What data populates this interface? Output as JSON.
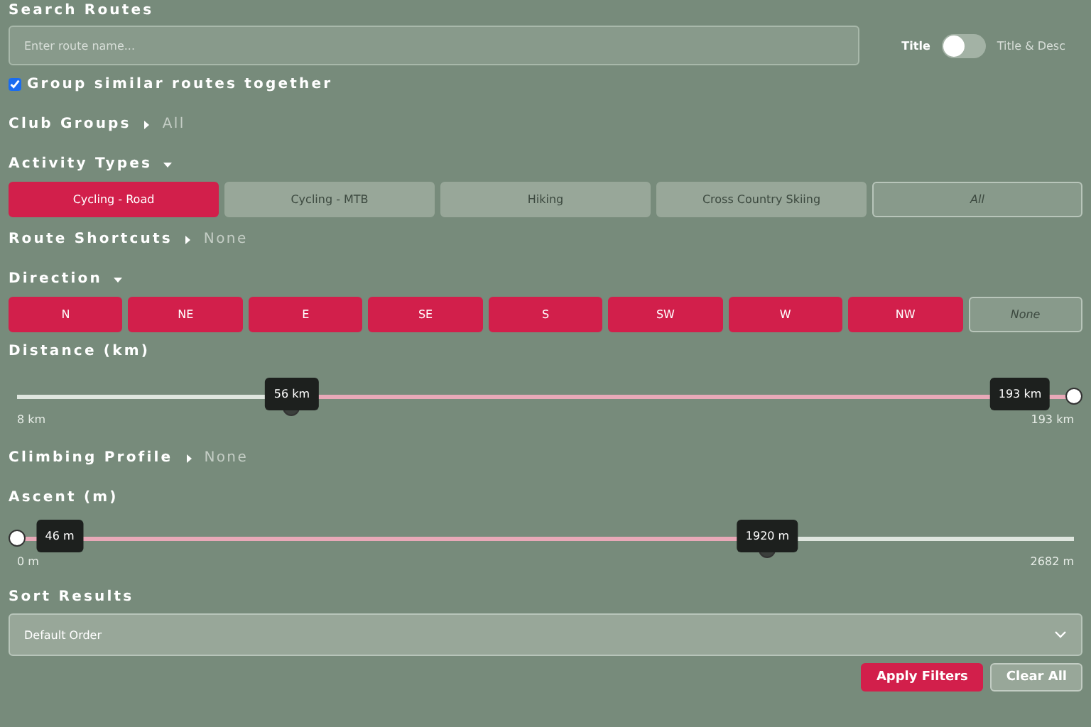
{
  "search": {
    "label": "Search Routes",
    "placeholder": "Enter route name...",
    "toggle": {
      "left_label": "Title",
      "right_label": "Title & Desc",
      "on": false
    }
  },
  "group_similar": {
    "label": "Group similar routes together",
    "checked": true
  },
  "club_groups": {
    "label": "Club Groups",
    "value": "All",
    "expanded": false
  },
  "activity_types": {
    "label": "Activity Types",
    "expanded": true,
    "options": [
      {
        "label": "Cycling - Road",
        "selected": true,
        "kind": "option"
      },
      {
        "label": "Cycling - MTB",
        "selected": false,
        "kind": "option"
      },
      {
        "label": "Hiking",
        "selected": false,
        "kind": "option"
      },
      {
        "label": "Cross Country Skiing",
        "selected": false,
        "kind": "option"
      },
      {
        "label": "All",
        "selected": false,
        "kind": "all"
      }
    ]
  },
  "route_shortcuts": {
    "label": "Route Shortcuts",
    "value": "None",
    "expanded": false
  },
  "direction": {
    "label": "Direction",
    "expanded": true,
    "options": [
      {
        "label": "N",
        "selected": true,
        "kind": "option"
      },
      {
        "label": "NE",
        "selected": true,
        "kind": "option"
      },
      {
        "label": "E",
        "selected": true,
        "kind": "option"
      },
      {
        "label": "SE",
        "selected": true,
        "kind": "option"
      },
      {
        "label": "S",
        "selected": true,
        "kind": "option"
      },
      {
        "label": "SW",
        "selected": true,
        "kind": "option"
      },
      {
        "label": "W",
        "selected": true,
        "kind": "option"
      },
      {
        "label": "NW",
        "selected": true,
        "kind": "option"
      },
      {
        "label": "None",
        "selected": false,
        "kind": "all"
      }
    ]
  },
  "distance": {
    "label": "Distance (km)",
    "min_label": "8 km",
    "max_label": "193 km",
    "thumbs": [
      {
        "level": 0.26,
        "reading": "56 km"
      },
      {
        "level": 1,
        "reading": "193 km"
      }
    ]
  },
  "climbing_profile": {
    "label": "Climbing Profile",
    "value": "None",
    "expanded": false
  },
  "ascent": {
    "label": "Ascent (m)",
    "min_label": "0 m",
    "max_label": "2682 m",
    "thumbs": [
      {
        "level": 0,
        "reading": "46 m"
      },
      {
        "level": 0.71,
        "reading": "1920 m"
      }
    ]
  },
  "sort": {
    "label": "Sort Results",
    "value": "Default Order"
  },
  "buttons": [
    {
      "label": "Apply Filters",
      "kind": "primary"
    },
    {
      "label": "Clear All",
      "kind": "secondary"
    }
  ]
}
